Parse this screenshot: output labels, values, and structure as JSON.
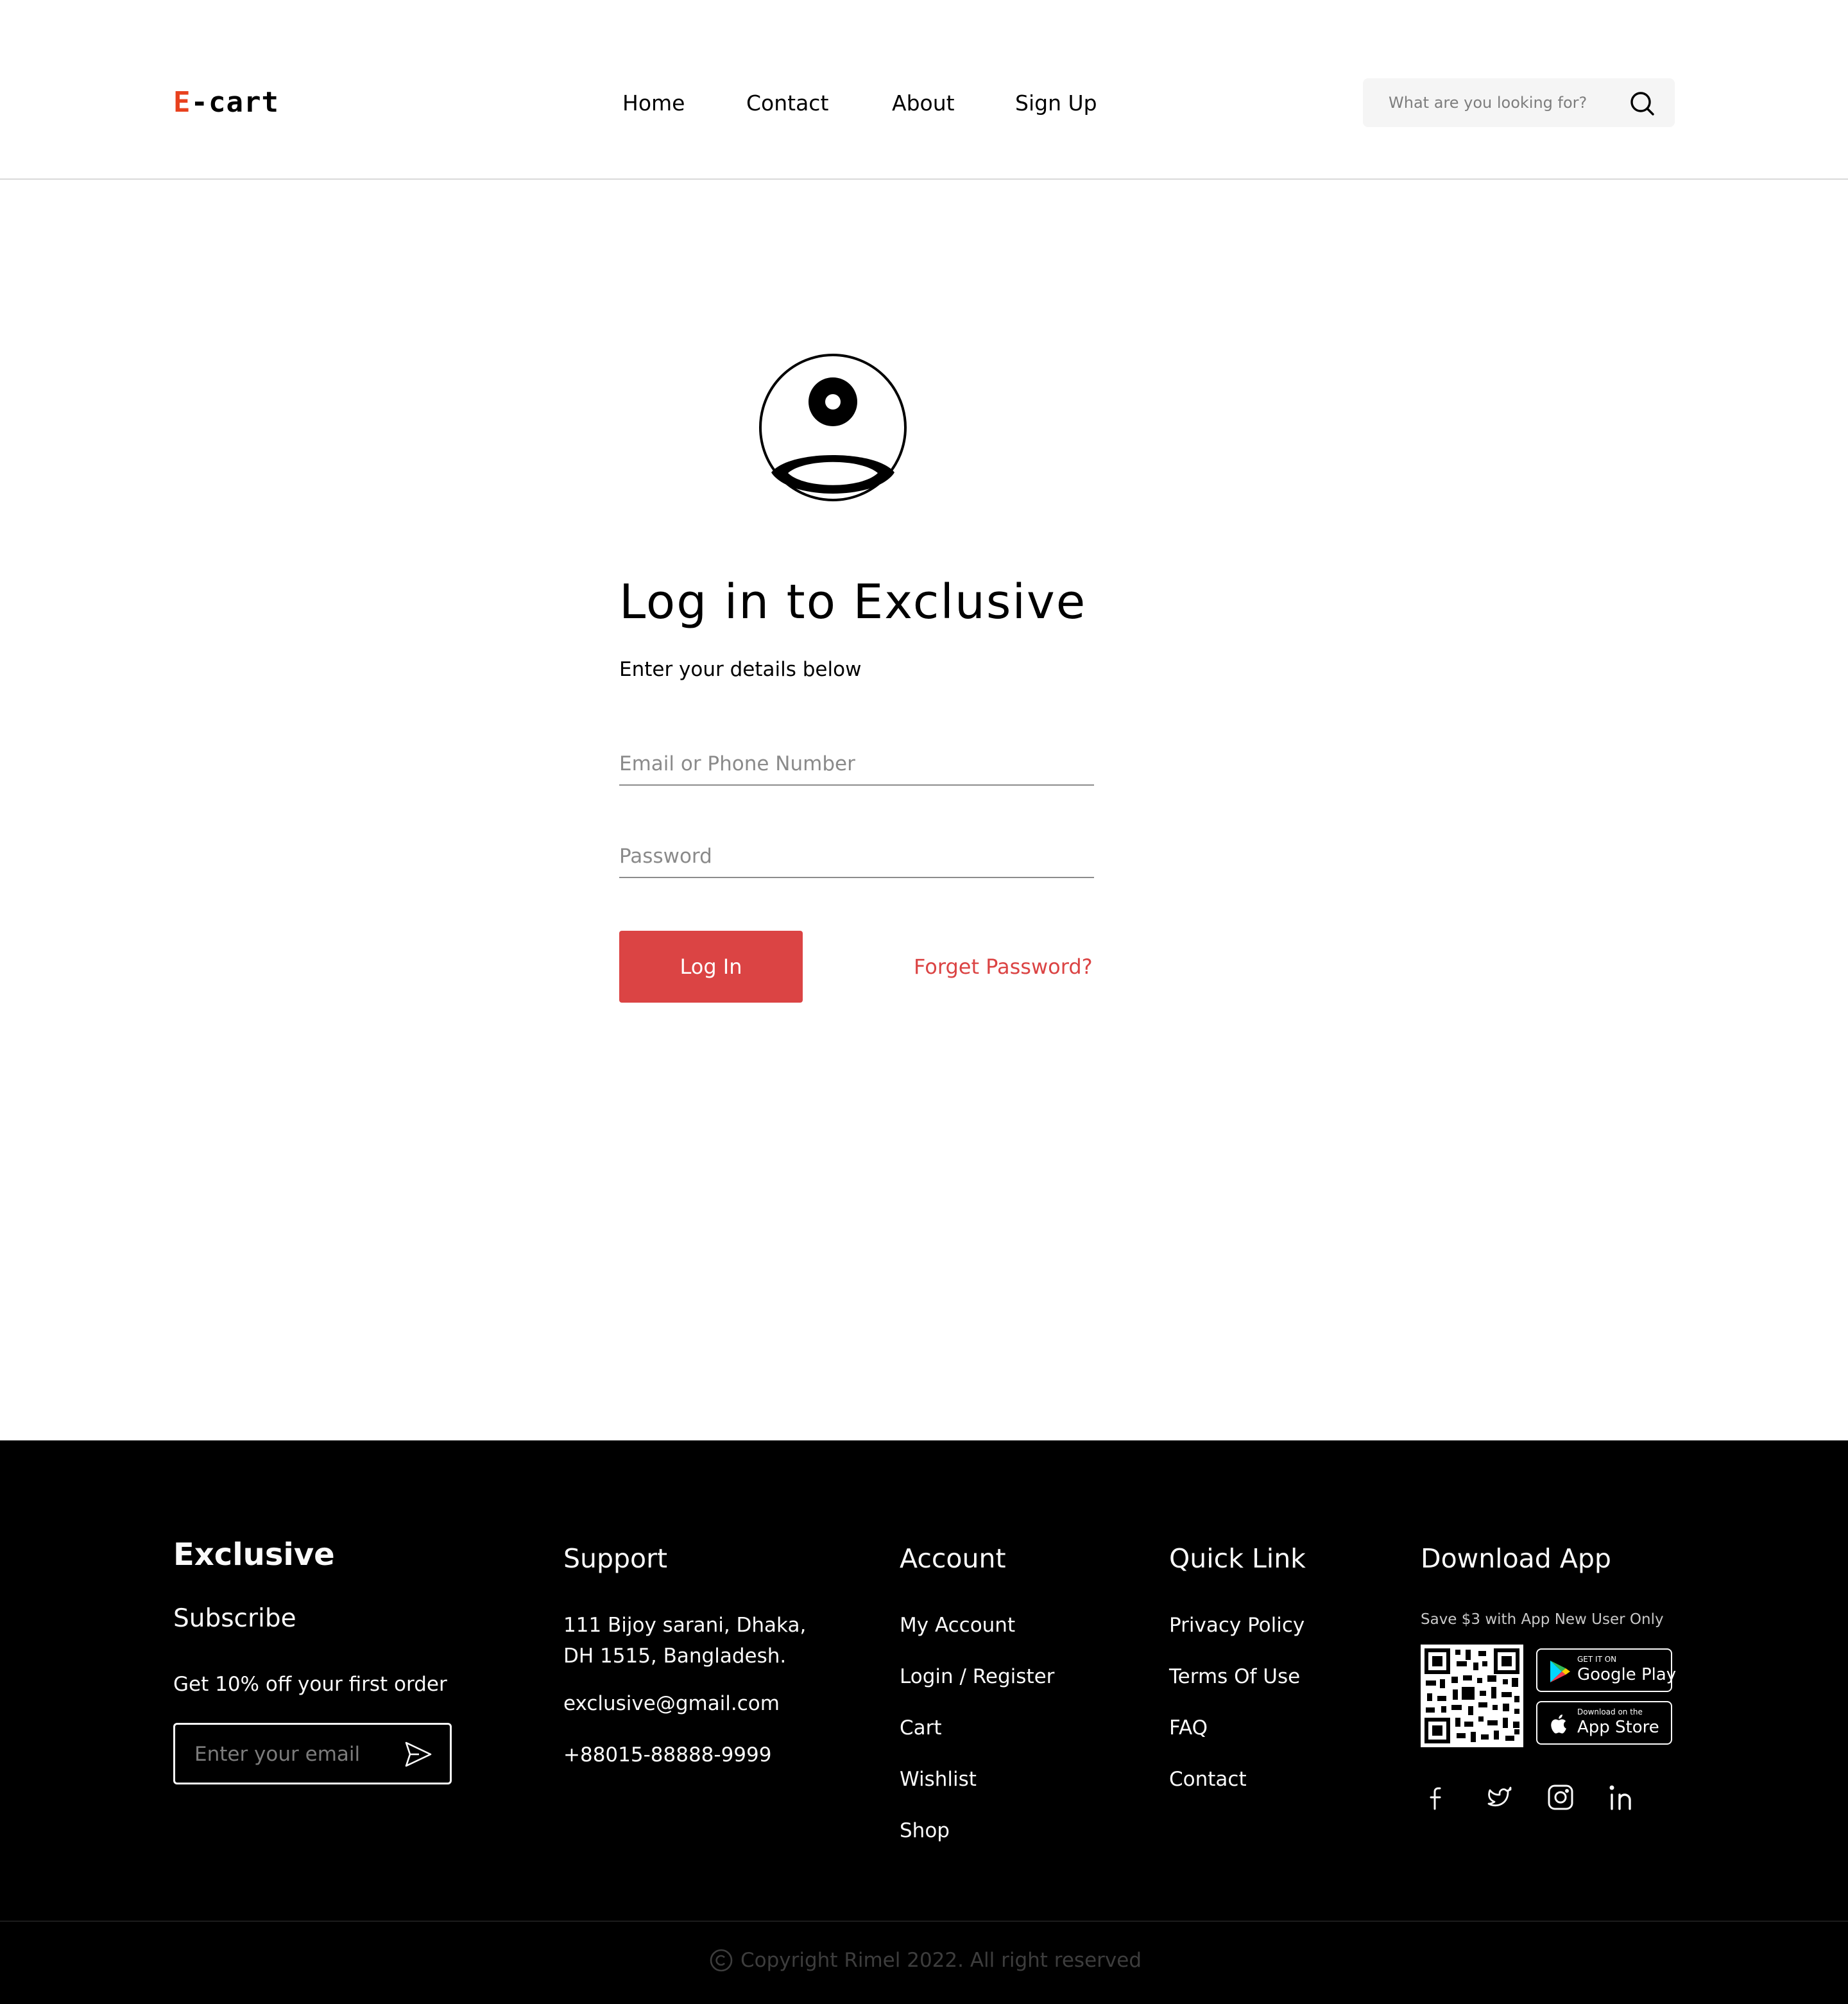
{
  "header": {
    "logo_accent": "E",
    "logo_rest": "-cart",
    "nav": {
      "home": "Home",
      "contact": "Contact",
      "about": "About",
      "signup": "Sign Up"
    },
    "search": {
      "placeholder": "What are you looking for?",
      "icon": "search-icon"
    }
  },
  "login": {
    "avatar_icon": "user-circle-icon",
    "title": "Log in to Exclusive",
    "subtitle": "Enter your details below",
    "email_placeholder": "Email or Phone Number",
    "password_placeholder": "Password",
    "button_label": "Log In",
    "forget_label": "Forget Password?"
  },
  "footer": {
    "brand": "Exclusive",
    "subscribe": "Subscribe",
    "offer": "Get 10% off your first order",
    "email_placeholder": "Enter your email",
    "support": {
      "title": "Support",
      "address_line1": "111 Bijoy sarani, Dhaka,",
      "address_line2": "DH 1515, Bangladesh.",
      "email": "exclusive@gmail.com",
      "phone": "+88015-88888-9999"
    },
    "account": {
      "title": "Account",
      "links": [
        "My Account",
        "Login / Register",
        "Cart",
        "Wishlist",
        "Shop"
      ]
    },
    "quick_link": {
      "title": "Quick Link",
      "links": [
        "Privacy Policy",
        "Terms Of Use",
        "FAQ",
        "Contact"
      ]
    },
    "download": {
      "title": "Download App",
      "note": "Save $3 with App New User Only",
      "google_small": "GET IT ON",
      "google_big": "Google Play",
      "apple_small": "Download on the",
      "apple_big": "App Store"
    },
    "social_icons": [
      "facebook-icon",
      "twitter-icon",
      "instagram-icon",
      "linkedin-icon"
    ],
    "copyright": "Copyright Rimel 2022. All right reserved"
  },
  "colors": {
    "accent": "#DB4444",
    "logo_accent": "#E8411E",
    "footer_bg": "#000000",
    "search_bg": "#F5F5F5"
  }
}
